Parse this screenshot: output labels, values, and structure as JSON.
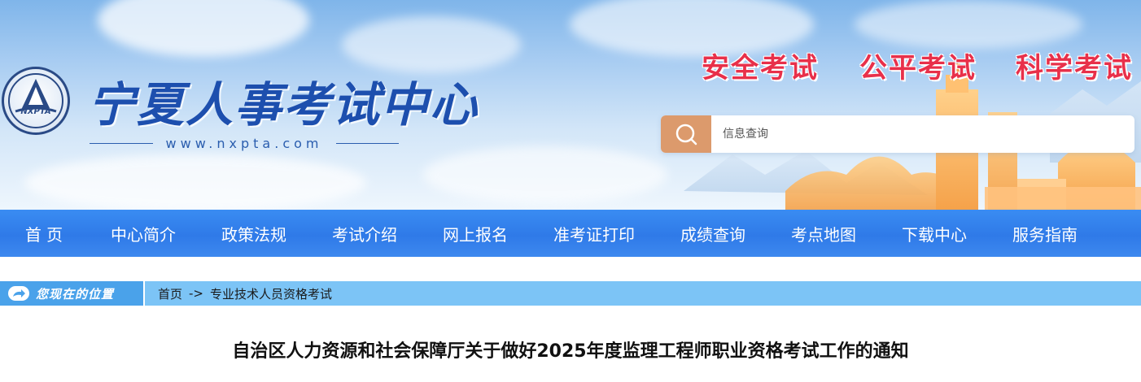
{
  "header": {
    "logo_title": "宁夏人事考试中心",
    "logo_abbr": "NXPTA",
    "logo_url": "www.nxpta.com",
    "slogans": [
      "安全考试",
      "公平考试",
      "科学考试"
    ],
    "search": {
      "placeholder": "信息查询",
      "value": ""
    }
  },
  "nav": {
    "items": [
      {
        "label": "首 页"
      },
      {
        "label": "中心简介"
      },
      {
        "label": "政策法规"
      },
      {
        "label": "考试介绍"
      },
      {
        "label": "网上报名"
      },
      {
        "label": "准考证打印"
      },
      {
        "label": "成绩查询"
      },
      {
        "label": "考点地图"
      },
      {
        "label": "下载中心"
      },
      {
        "label": "服务指南"
      }
    ]
  },
  "breadcrumb": {
    "label": "您现在的位置",
    "home": "首页",
    "separator": "->",
    "current": "专业技术人员资格考试"
  },
  "article": {
    "title": "自治区人力资源和社会保障厅关于做好2025年度监理工程师职业资格考试工作的通知"
  },
  "colors": {
    "nav_bg": "#2f7ae8",
    "slogan": "#e8304a",
    "logo_blue": "#1d4fae",
    "search_btn": "#dc9a6c",
    "crumb_bar": "#7cc4f6"
  }
}
